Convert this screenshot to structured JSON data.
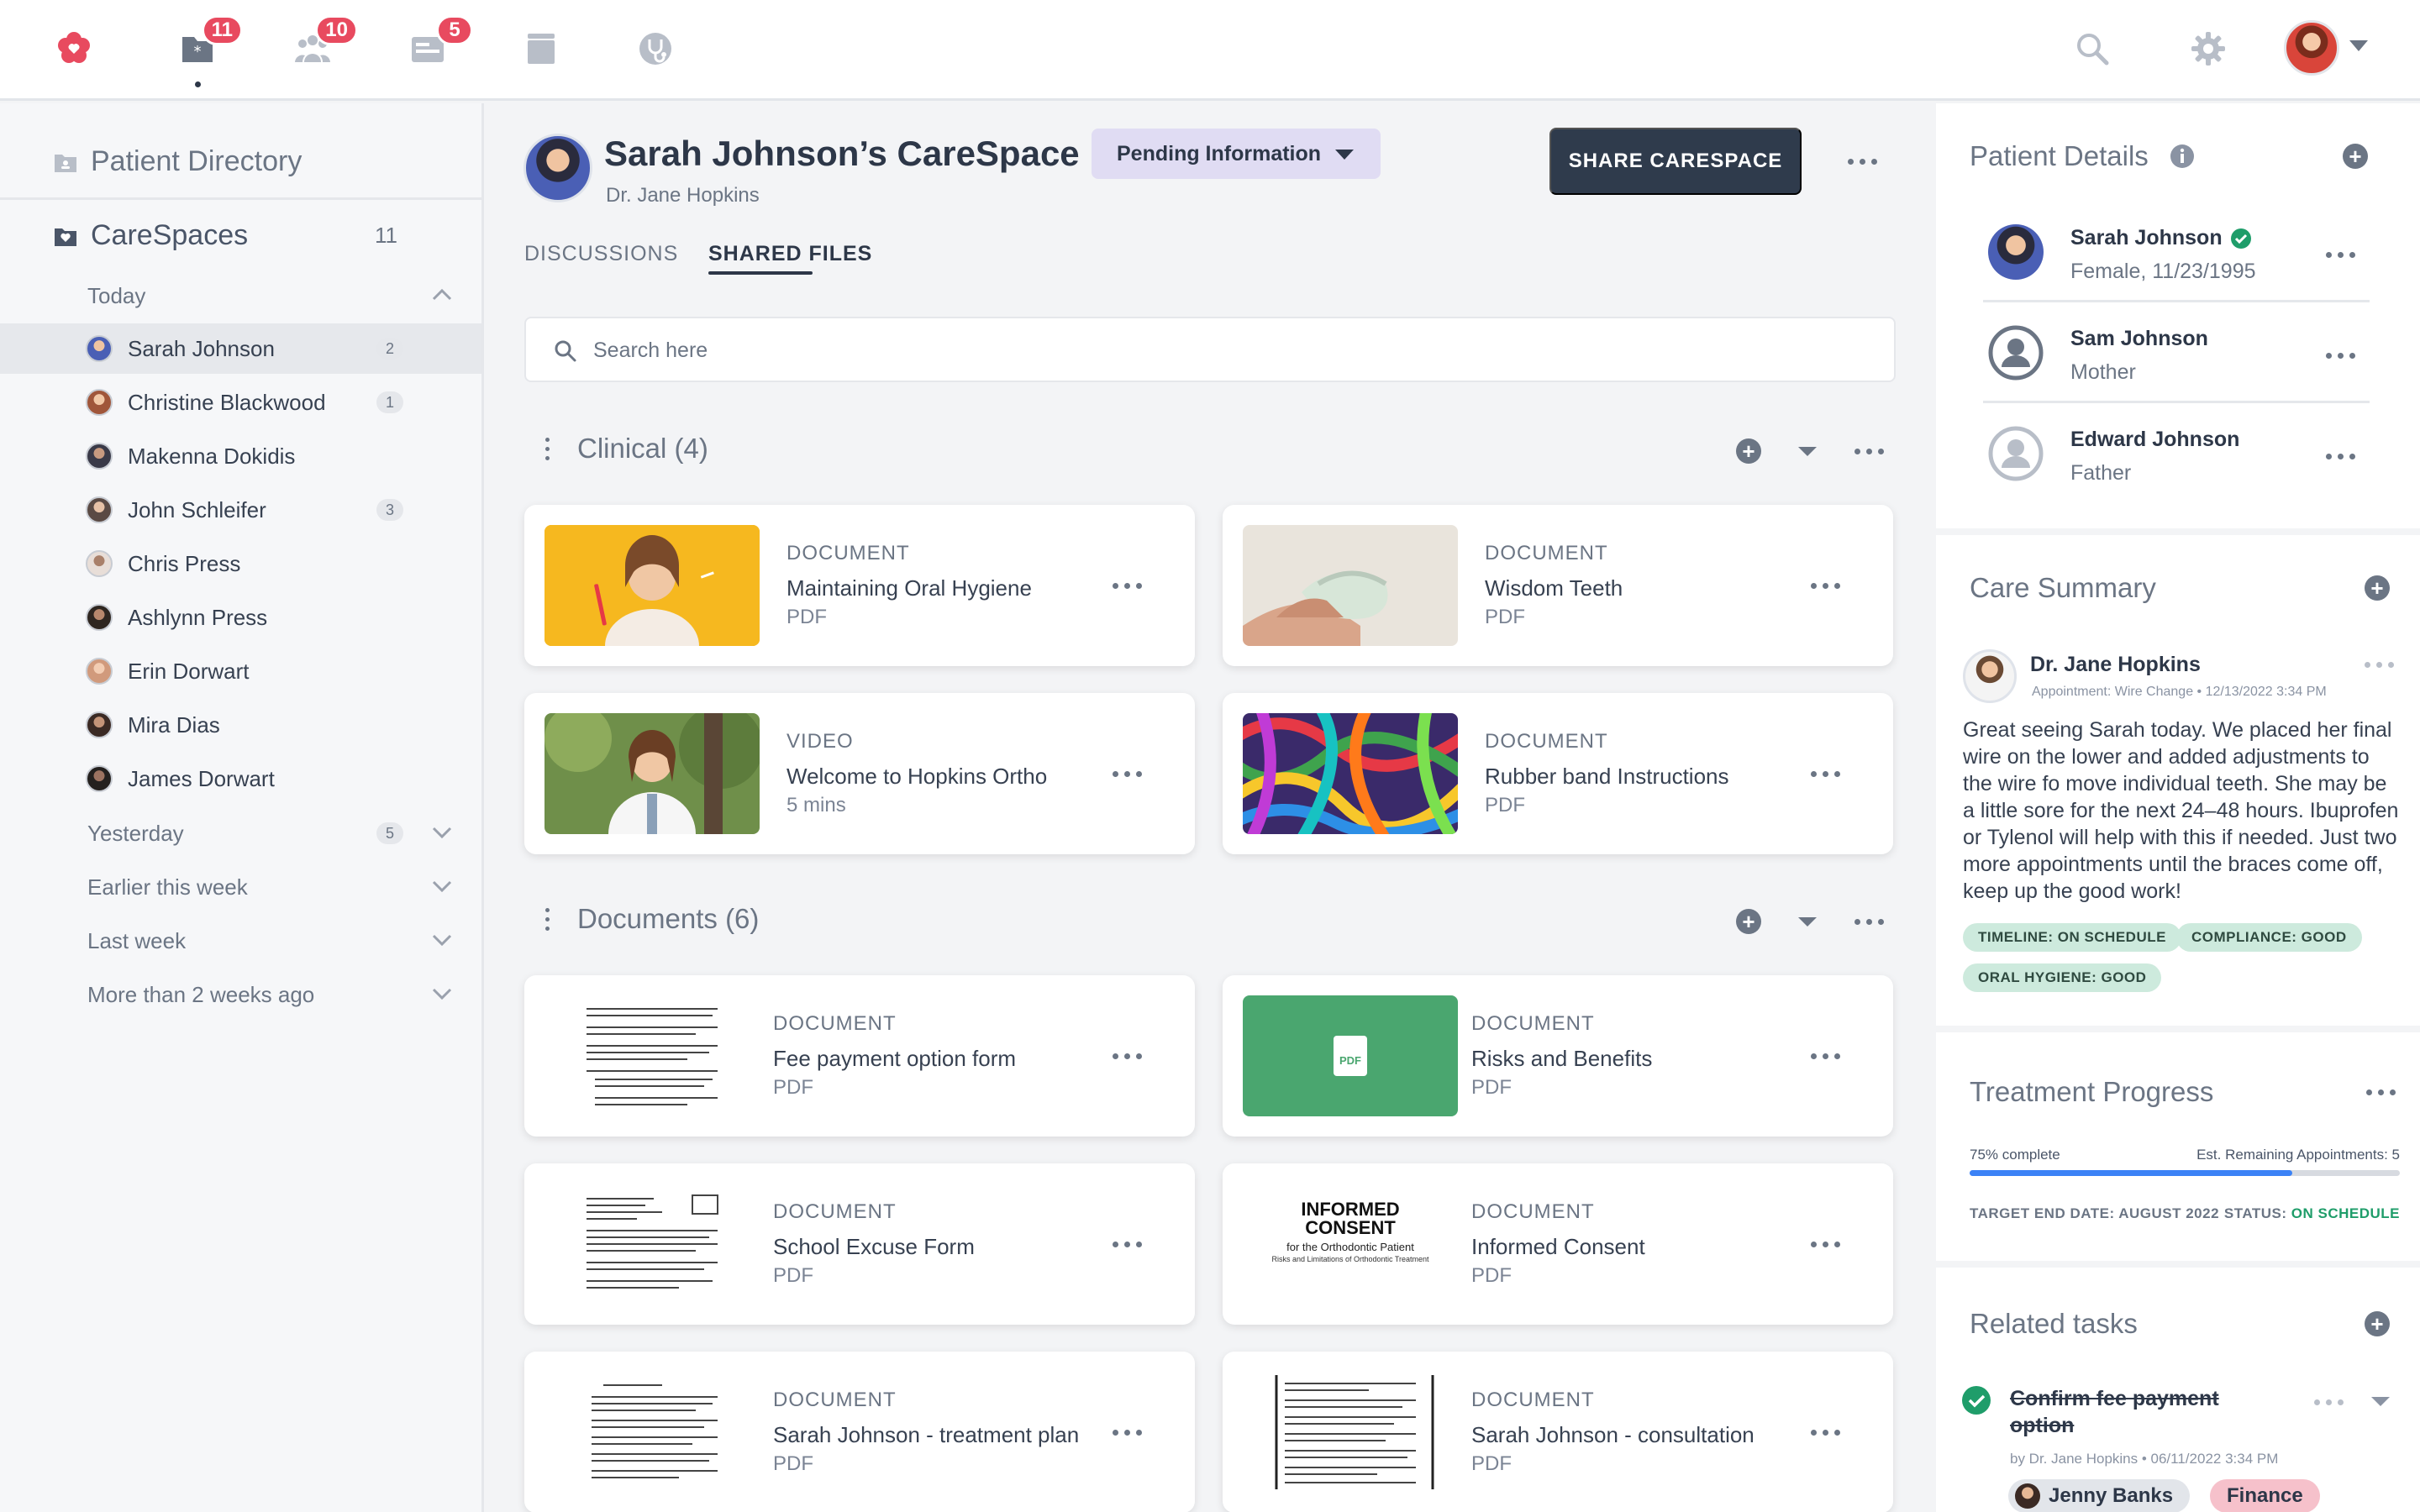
{
  "nav": {
    "brand_icon": "heart-flower-icon",
    "icons": [
      {
        "name": "carespaces-icon",
        "badge": "11"
      },
      {
        "name": "team-icon",
        "badge": "10"
      },
      {
        "name": "inbox-icon",
        "badge": "5"
      },
      {
        "name": "archive-icon",
        "badge": ""
      },
      {
        "name": "stethoscope-icon",
        "badge": ""
      }
    ],
    "right_icons": [
      "search-icon",
      "gear-icon"
    ],
    "accent": "#e84a5f"
  },
  "sidebar": {
    "directory_label": "Patient Directory",
    "carespaces_label": "CareSpaces",
    "carespaces_count": "11",
    "groups": [
      {
        "label": "Today",
        "count": ""
      },
      {
        "label": "Yesterday",
        "count": "5"
      },
      {
        "label": "Earlier this week",
        "count": ""
      },
      {
        "label": "Last week",
        "count": ""
      },
      {
        "label": "More than 2 weeks ago",
        "count": ""
      }
    ],
    "patients": [
      {
        "name": "Sarah Johnson",
        "count": "2",
        "color": "#4a5fb5"
      },
      {
        "name": "Christine Blackwood",
        "count": "1",
        "color": "#a0563a"
      },
      {
        "name": "Makenna Dokidis",
        "count": "",
        "color": "#3a3a48"
      },
      {
        "name": "John Schleifer",
        "count": "3",
        "color": "#5a4a44"
      },
      {
        "name": "Chris Press",
        "count": "",
        "color": "#d8c8c0"
      },
      {
        "name": "Ashlynn Press",
        "count": "",
        "color": "#2e2620"
      },
      {
        "name": "Erin Dorwart",
        "count": "",
        "color": "#d19a7c"
      },
      {
        "name": "Mira Dias",
        "count": "",
        "color": "#3b2a24"
      },
      {
        "name": "James Dorwart",
        "count": "",
        "color": "#24201e"
      }
    ]
  },
  "header": {
    "title": "Sarah Johnson’s CareSpace",
    "subtitle": "Dr. Jane Hopkins",
    "status": "Pending Information",
    "share_label": "SHARE CARESPACE"
  },
  "tabs": [
    {
      "label": "DISCUSSIONS"
    },
    {
      "label": "SHARED FILES"
    }
  ],
  "search": {
    "placeholder": "Search here"
  },
  "sections": [
    {
      "title": "Clinical (4)",
      "items": [
        {
          "type": "DOCUMENT",
          "title": "Maintaining Oral Hygiene",
          "meta": "PDF"
        },
        {
          "type": "DOCUMENT",
          "title": "Wisdom Teeth",
          "meta": "PDF"
        },
        {
          "type": "VIDEO",
          "title": "Welcome to Hopkins Ortho",
          "meta": "5 mins"
        },
        {
          "type": "DOCUMENT",
          "title": "Rubber band Instructions",
          "meta": "PDF"
        }
      ]
    },
    {
      "title": "Documents (6)",
      "items": [
        {
          "type": "DOCUMENT",
          "title": "Fee payment option form",
          "meta": "PDF"
        },
        {
          "type": "DOCUMENT",
          "title": "Risks and Benefits",
          "meta": "PDF",
          "thumb_label": "PDF"
        },
        {
          "type": "DOCUMENT",
          "title": "School Excuse Form",
          "meta": "PDF"
        },
        {
          "type": "DOCUMENT",
          "title": "Informed Consent",
          "meta": "PDF",
          "thumb_lines": [
            "INFORMED",
            "CONSENT",
            "for the Orthodontic Patient",
            "Risks and Limitations of Orthodontic Treatment"
          ]
        },
        {
          "type": "DOCUMENT",
          "title": "Sarah Johnson - treatment plan",
          "meta": "PDF"
        },
        {
          "type": "DOCUMENT",
          "title": "Sarah Johnson - consultation",
          "meta": "PDF"
        }
      ]
    }
  ],
  "patient_details": {
    "title": "Patient Details",
    "people": [
      {
        "name": "Sarah Johnson",
        "sub": "Female, 11/23/1995",
        "verified": true
      },
      {
        "name": "Sam Johnson",
        "sub": "Mother",
        "verified": false
      },
      {
        "name": "Edward Johnson",
        "sub": "Father",
        "verified": false
      }
    ]
  },
  "care_summary": {
    "title": "Care Summary",
    "author": "Dr. Jane Hopkins",
    "meta": "Appointment: Wire Change • 12/13/2022 3:34 PM",
    "note": "Great seeing Sarah today. We placed her final wire on the lower and added adjustments to the wire fo move individual teeth. She may be a little sore for the next 24–48 hours. Ibuprofen or Tylenol will help with this if needed. Just two more appointments until the braces come off, keep up the good work!",
    "chips": [
      "TIMELINE: ON SCHEDULE",
      "COMPLIANCE: GOOD",
      "ORAL HYGIENE: GOOD"
    ]
  },
  "treatment": {
    "title": "Treatment Progress",
    "complete_label": "75% complete",
    "progress": 0.75,
    "remaining_label": "Est. Remaining Appointments: 5",
    "target_label": "TARGET END DATE: AUGUST 2022",
    "status_prefix": "STATUS: ",
    "status_value": "ON SCHEDULE",
    "status_color": "#1f9d6a"
  },
  "tasks": {
    "title": "Related tasks",
    "items": [
      {
        "title": "Confirm fee payment option",
        "meta": "by Dr. Jane Hopkins • 06/11/2022 3:34 PM",
        "assignee": "Jenny Banks",
        "tag": "Finance"
      }
    ]
  }
}
